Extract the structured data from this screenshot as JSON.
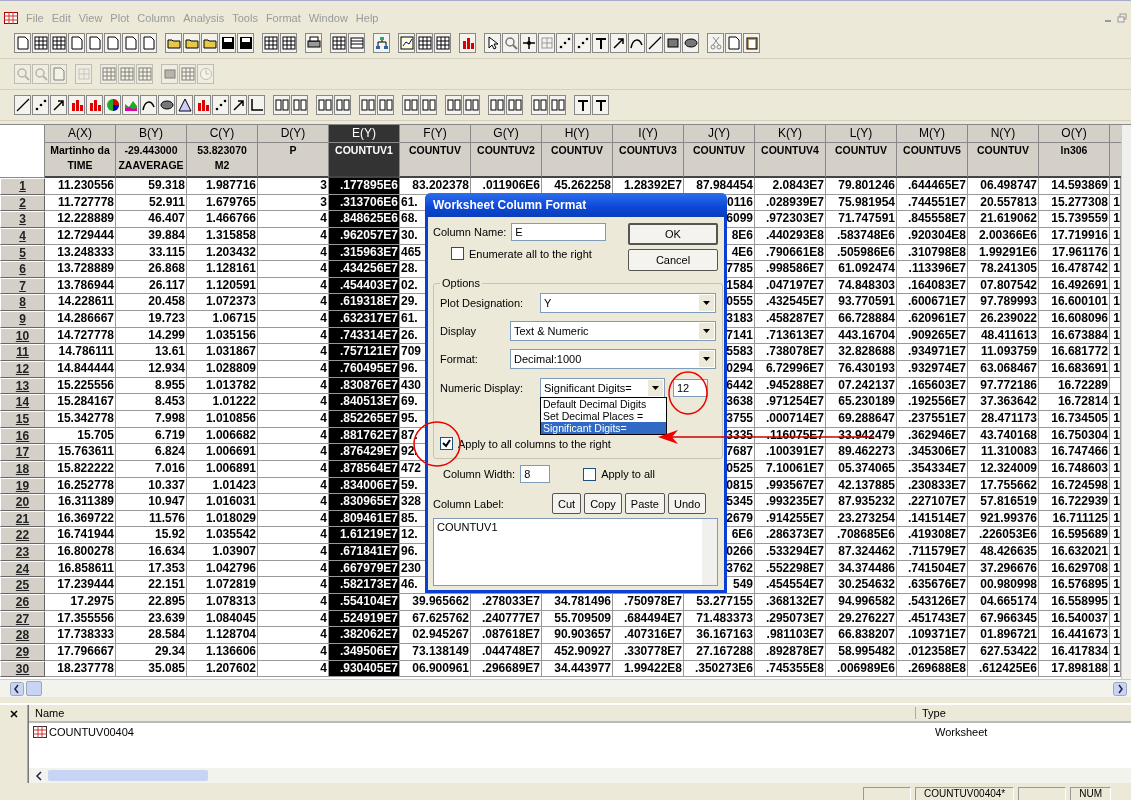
{
  "menu": [
    {
      "label": "File"
    },
    {
      "label": "Edit"
    },
    {
      "label": "View"
    },
    {
      "label": "Plot"
    },
    {
      "label": "Column"
    },
    {
      "label": "Analysis"
    },
    {
      "label": "Tools"
    },
    {
      "label": "Format"
    },
    {
      "label": "Window"
    },
    {
      "label": "Help"
    }
  ],
  "worksheet": {
    "columns": [
      {
        "name": "A(X)",
        "label": [
          "Martinho da",
          "TIME"
        ],
        "selected": false
      },
      {
        "name": "B(Y)",
        "label": [
          "-29.443000",
          "ZAAVERAGE"
        ],
        "selected": false
      },
      {
        "name": "C(Y)",
        "label": [
          "53.823070",
          "M2"
        ],
        "selected": false
      },
      {
        "name": "D(Y)",
        "label": [
          "P"
        ],
        "selected": false
      },
      {
        "name": "E(Y)",
        "label": [
          "COUNTUV1"
        ],
        "selected": true
      },
      {
        "name": "F(Y)",
        "label": [
          "COUNTUV"
        ],
        "selected": false
      },
      {
        "name": "G(Y)",
        "label": [
          "COUNTUV2"
        ],
        "selected": false
      },
      {
        "name": "H(Y)",
        "label": [
          "COUNTUV"
        ],
        "selected": false
      },
      {
        "name": "I(Y)",
        "label": [
          "COUNTUV3"
        ],
        "selected": false
      },
      {
        "name": "J(Y)",
        "label": [
          "COUNTUV"
        ],
        "selected": false
      },
      {
        "name": "K(Y)",
        "label": [
          "COUNTUV4"
        ],
        "selected": false
      },
      {
        "name": "L(Y)",
        "label": [
          "COUNTUV"
        ],
        "selected": false
      },
      {
        "name": "M(Y)",
        "label": [
          "COUNTUV5"
        ],
        "selected": false
      },
      {
        "name": "N(Y)",
        "label": [
          "COUNTUV"
        ],
        "selected": false
      },
      {
        "name": "O(Y)",
        "label": [
          "ln306"
        ],
        "selected": false
      }
    ],
    "rows": [
      {
        "number": "1",
        "cells": [
          "11.230556",
          "59.318",
          "1.987716",
          "3",
          ".177895E6",
          "83.202378",
          ".011906E6",
          "45.262258",
          "1.28392E7",
          "87.984454",
          "2.0843E7",
          "79.801246",
          ".644465E7",
          "06.498747",
          "14.593869",
          "1"
        ]
      },
      {
        "number": "2",
        "cells": [
          "11.727778",
          "52.911",
          "1.679765",
          "3",
          ".313706E6",
          "61.",
          null,
          null,
          null,
          "0116",
          ".028939E7",
          "75.981954",
          ".744551E7",
          "20.557813",
          "15.277308",
          "1"
        ]
      },
      {
        "number": "3",
        "cells": [
          "12.228889",
          "46.407",
          "1.466766",
          "4",
          ".848625E6",
          "68.",
          null,
          null,
          null,
          "6099",
          ".972303E7",
          "71.747591",
          ".845558E7",
          "21.619062",
          "15.739559",
          "1"
        ]
      },
      {
        "number": "4",
        "cells": [
          "12.729444",
          "39.884",
          "1.315858",
          "4",
          ".962057E7",
          "30.",
          null,
          null,
          null,
          "8E6",
          ".440293E8",
          ".583748E6",
          ".920304E8",
          "2.00366E6",
          "17.719916",
          "1"
        ]
      },
      {
        "number": "5",
        "cells": [
          "13.248333",
          "33.115",
          "1.203432",
          "4",
          ".315963E7",
          "465",
          null,
          null,
          null,
          "4E6",
          ".790661E8",
          ".505986E6",
          ".310798E8",
          "1.99291E6",
          "17.961176",
          "1"
        ]
      },
      {
        "number": "6",
        "cells": [
          "13.728889",
          "26.868",
          "1.128161",
          "4",
          ".434256E7",
          "28.",
          null,
          null,
          null,
          "7785",
          ".998586E7",
          "61.092474",
          ".113396E7",
          "78.241305",
          "16.478742",
          "1"
        ]
      },
      {
        "number": "7",
        "cells": [
          "13.786944",
          "26.117",
          "1.120591",
          "4",
          ".454403E7",
          "02.",
          null,
          null,
          null,
          "1584",
          ".047197E7",
          "74.848303",
          ".164083E7",
          "07.807542",
          "16.492691",
          "1"
        ]
      },
      {
        "number": "8",
        "cells": [
          "14.228611",
          "20.458",
          "1.072373",
          "4",
          ".619318E7",
          "29.",
          null,
          null,
          null,
          "0555",
          ".432545E7",
          "93.770591",
          ".600671E7",
          "97.789993",
          "16.600101",
          "1"
        ]
      },
      {
        "number": "9",
        "cells": [
          "14.286667",
          "19.723",
          "1.06715",
          "4",
          ".632317E7",
          "61.",
          null,
          null,
          null,
          "3183",
          ".458287E7",
          "66.728884",
          ".620961E7",
          "26.239022",
          "16.608096",
          "1"
        ]
      },
      {
        "number": "10",
        "cells": [
          "14.727778",
          "14.299",
          "1.035156",
          "4",
          ".743314E7",
          "26.",
          null,
          null,
          null,
          "7141",
          ".713613E7",
          "443.16704",
          ".909265E7",
          "48.411613",
          "16.673884",
          "1"
        ]
      },
      {
        "number": "11",
        "cells": [
          "14.786111",
          "13.61",
          "1.031867",
          "4",
          ".757121E7",
          "709",
          null,
          null,
          null,
          "5583",
          ".738078E7",
          "32.828688",
          ".934971E7",
          "11.093759",
          "16.681772",
          "1"
        ]
      },
      {
        "number": "12",
        "cells": [
          "14.844444",
          "12.934",
          "1.028809",
          "4",
          ".760495E7",
          "96.",
          null,
          null,
          null,
          "0294",
          "6.72996E7",
          "76.430193",
          ".932974E7",
          "63.068467",
          "16.683691",
          "1"
        ]
      },
      {
        "number": "13",
        "cells": [
          "15.225556",
          "8.955",
          "1.013782",
          "4",
          ".830876E7",
          "430",
          null,
          null,
          null,
          "6442",
          ".945288E7",
          "07.242137",
          ".165603E7",
          "97.772186",
          "16.72289",
          null
        ]
      },
      {
        "number": "14",
        "cells": [
          "15.284167",
          "8.453",
          "1.01222",
          "4",
          ".840513E7",
          "69.",
          null,
          null,
          null,
          "3638",
          ".971254E7",
          "65.230189",
          ".192556E7",
          "37.363642",
          "16.72814",
          "1"
        ]
      },
      {
        "number": "15",
        "cells": [
          "15.342778",
          "7.998",
          "1.010856",
          "4",
          ".852265E7",
          "95.",
          null,
          null,
          null,
          "3755",
          ".000714E7",
          "69.288647",
          ".237551E7",
          "28.471173",
          "16.734505",
          "1"
        ]
      },
      {
        "number": "16",
        "cells": [
          "15.705",
          "6.719",
          "1.006682",
          "4",
          ".881762E7",
          "87.",
          null,
          null,
          null,
          "3335",
          ".116075E7",
          "33.942479",
          ".362946E7",
          "43.740168",
          "16.750304",
          "1"
        ]
      },
      {
        "number": "17",
        "cells": [
          "15.763611",
          "6.824",
          "1.006691",
          "4",
          ".876429E7",
          "92.",
          null,
          null,
          null,
          "7687",
          ".100391E7",
          "89.462273",
          ".345306E7",
          "11.310083",
          "16.747466",
          "1"
        ]
      },
      {
        "number": "18",
        "cells": [
          "15.822222",
          "7.016",
          "1.006891",
          "4",
          ".878564E7",
          "472",
          null,
          null,
          null,
          "0525",
          "7.10061E7",
          "05.374065",
          ".354334E7",
          "12.324009",
          "16.748603",
          "1"
        ]
      },
      {
        "number": "19",
        "cells": [
          "16.252778",
          "10.337",
          "1.01423",
          "4",
          ".834006E7",
          "59.",
          null,
          null,
          null,
          "0815",
          ".993567E7",
          "42.137885",
          ".230833E7",
          "17.755662",
          "16.724598",
          "1"
        ]
      },
      {
        "number": "20",
        "cells": [
          "16.311389",
          "10.947",
          "1.016031",
          "4",
          ".830965E7",
          "328",
          null,
          null,
          null,
          "5345",
          ".993235E7",
          "87.935232",
          ".227107E7",
          "57.816519",
          "16.722939",
          "1"
        ]
      },
      {
        "number": "21",
        "cells": [
          "16.369722",
          "11.576",
          "1.018029",
          "4",
          ".809461E7",
          "85.",
          null,
          null,
          null,
          "2679",
          ".914255E7",
          "23.273254",
          ".141514E7",
          "921.99376",
          "16.711125",
          "1"
        ]
      },
      {
        "number": "22",
        "cells": [
          "16.741944",
          "15.92",
          "1.035542",
          "4",
          "1.61219E7",
          "12.",
          null,
          null,
          null,
          "6E6",
          ".286373E7",
          ".708685E6",
          ".419308E7",
          ".226053E6",
          "16.595689",
          "1"
        ]
      },
      {
        "number": "23",
        "cells": [
          "16.800278",
          "16.634",
          "1.03907",
          "4",
          ".671841E7",
          "96.",
          null,
          null,
          null,
          "0266",
          ".533294E7",
          "87.324462",
          ".711579E7",
          "48.426635",
          "16.632021",
          "1"
        ]
      },
      {
        "number": "24",
        "cells": [
          "16.858611",
          "17.353",
          "1.042796",
          "4",
          ".667979E7",
          "230",
          null,
          null,
          null,
          "3762",
          ".552298E7",
          "34.374486",
          ".741504E7",
          "37.296676",
          "16.629708",
          "1"
        ]
      },
      {
        "number": "25",
        "cells": [
          "17.239444",
          "22.151",
          "1.072819",
          "4",
          ".582173E7",
          "46.",
          null,
          null,
          null,
          "549",
          ".454554E7",
          "30.254632",
          ".635676E7",
          "00.980998",
          "16.576895",
          "1"
        ]
      },
      {
        "number": "26",
        "cells": [
          "17.2975",
          "22.895",
          "1.078313",
          "4",
          ".554104E7",
          "39.965662",
          ".278033E7",
          "34.781496",
          ".750978E7",
          "53.277155",
          ".368132E7",
          "94.996582",
          ".543126E7",
          "04.665174",
          "16.558995",
          "1"
        ]
      },
      {
        "number": "27",
        "cells": [
          "17.355556",
          "23.639",
          "1.084045",
          "4",
          ".524919E7",
          "67.625762",
          ".240777E7",
          "55.709509",
          ".684494E7",
          "71.483373",
          ".295073E7",
          "29.276227",
          ".451743E7",
          "67.966345",
          "16.540037",
          "1"
        ]
      },
      {
        "number": "28",
        "cells": [
          "17.738333",
          "28.584",
          "1.128704",
          "4",
          ".382062E7",
          "02.945267",
          ".087618E7",
          "90.903657",
          ".407316E7",
          "36.167163",
          ".981103E7",
          "66.838207",
          ".109371E7",
          "01.896721",
          "16.441673",
          "1"
        ]
      },
      {
        "number": "29",
        "cells": [
          "17.796667",
          "29.34",
          "1.136606",
          "4",
          ".349506E7",
          "73.138149",
          ".044748E7",
          "452.90927",
          ".330778E7",
          "27.167288",
          ".892878E7",
          "58.995482",
          ".012358E7",
          "627.53422",
          "16.417834",
          "1"
        ]
      },
      {
        "number": "30",
        "cells": [
          "18.237778",
          "35.085",
          "1.207602",
          "4",
          ".930405E7",
          "06.900961",
          ".296689E7",
          "34.443977",
          "1.99422E8",
          ".350273E6",
          ".745355E8",
          ".006989E6",
          ".269688E8",
          ".612425E6",
          "17.898188",
          "1"
        ]
      }
    ]
  },
  "dialog": {
    "title": "Worksheet Column Format",
    "column_name": {
      "label": "Column Name:",
      "value": "E"
    },
    "enumerate": {
      "label": "Enumerate all to the right",
      "checked": false
    },
    "buttons": [
      {
        "label": "OK"
      },
      {
        "label": "Cancel"
      }
    ],
    "options": {
      "title": "Options",
      "fields": [
        {
          "label": "Plot Designation:",
          "value": "Y"
        },
        {
          "label": "Display",
          "value": "Text & Numeric"
        },
        {
          "label": "Format:",
          "value": "Decimal:1000"
        }
      ],
      "numeric_display": {
        "label": "Numeric Display:",
        "value": "Significant Digits=",
        "digits": "12",
        "choices": [
          {
            "label": "Default Decimal Digits",
            "selected": false
          },
          {
            "label": "Set Decimal Places =",
            "selected": false
          },
          {
            "label": "Significant Digits=",
            "selected": true
          }
        ]
      },
      "apply_right": {
        "label": "Apply to all columns to the right",
        "checked": true
      }
    },
    "column_width": {
      "label": "Column Width:",
      "value": "8"
    },
    "apply_all": {
      "label": "Apply to all",
      "checked": false
    },
    "column_label": {
      "label": "Column Label:",
      "buttons": [
        {
          "label": "Cut"
        },
        {
          "label": "Copy"
        },
        {
          "label": "Paste"
        },
        {
          "label": "Undo"
        }
      ],
      "value": "COUNTUV1"
    }
  },
  "explorer": {
    "columns": [
      {
        "label": "Name"
      },
      {
        "label": "Type"
      }
    ],
    "items": [
      {
        "name": "COUNTUV00404",
        "type": "Worksheet"
      }
    ]
  },
  "status_bar": [
    {
      "text": "COUNTUV00404*"
    },
    {
      "text": "NUM"
    }
  ]
}
